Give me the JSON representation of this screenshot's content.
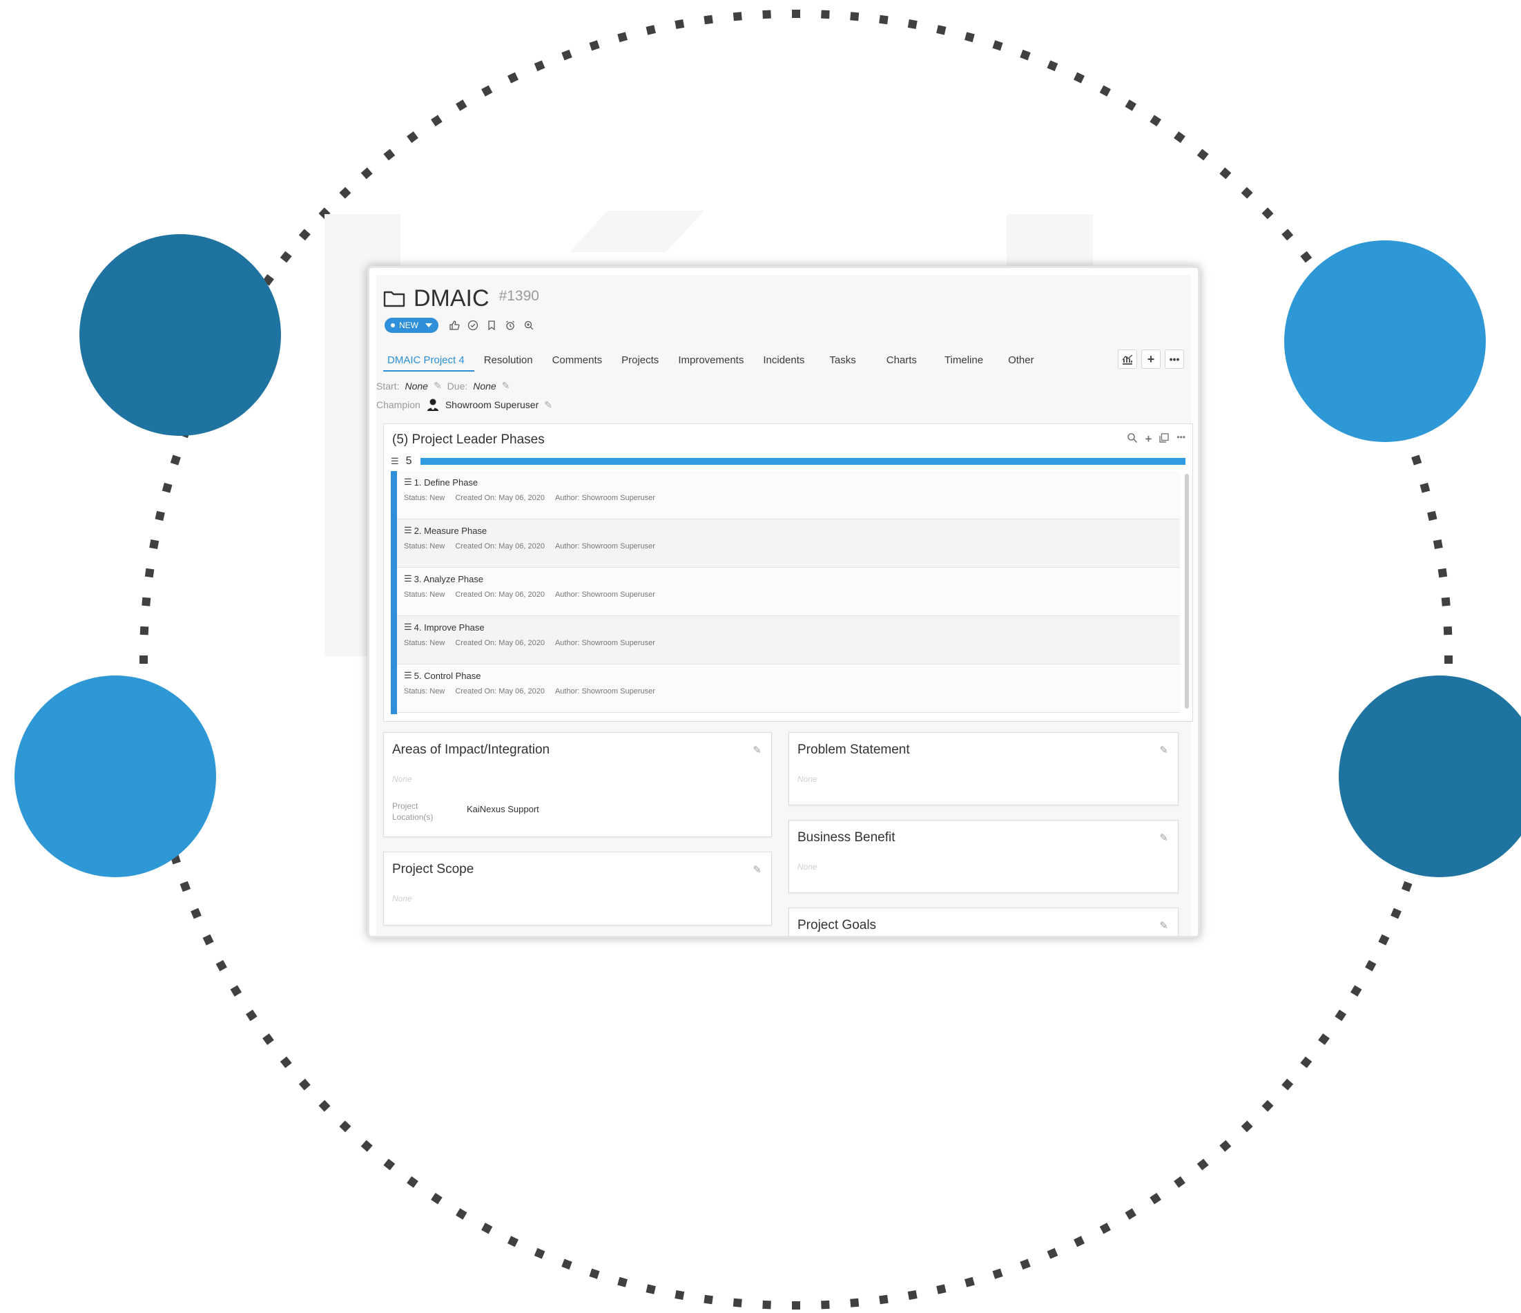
{
  "colors": {
    "dark_blue": "#1f73a0",
    "light_blue": "#2e98d6",
    "accent": "#2f8fd8",
    "dots": "#404040"
  },
  "app": {
    "title": "DMAIC",
    "number": "#1390",
    "status": "NEW",
    "action_icons": [
      "thumbs-up-icon",
      "check-circle-icon",
      "bookmark-icon",
      "alarm-clock-icon",
      "zoom-icon"
    ]
  },
  "tabs": [
    {
      "label": "DMAIC Project 4",
      "active": true
    },
    {
      "label": "Resolution"
    },
    {
      "label": "Comments"
    },
    {
      "label": "Projects"
    },
    {
      "label": "Improvements"
    },
    {
      "label": "Incidents"
    },
    {
      "label": "Tasks"
    },
    {
      "label": "Charts"
    },
    {
      "label": "Timeline"
    },
    {
      "label": "Other"
    }
  ],
  "toolbar_icons": [
    "chart-icon",
    "plus-icon",
    "more-icon"
  ],
  "meta": {
    "start_label": "Start:",
    "start_value": "None",
    "due_label": "Due:",
    "due_value": "None",
    "champion_label": "Champion",
    "champion_value": "Showroom Superuser"
  },
  "phases_panel": {
    "title": "(5) Project Leader Phases",
    "count": "5",
    "progress": 1.0,
    "items": [
      {
        "title": "1. Define Phase",
        "status": "Status: New",
        "created": "Created On: May 06, 2020",
        "author": "Author: Showroom Superuser"
      },
      {
        "title": "2. Measure Phase",
        "status": "Status: New",
        "created": "Created On: May 06, 2020",
        "author": "Author: Showroom Superuser"
      },
      {
        "title": "3. Analyze Phase",
        "status": "Status: New",
        "created": "Created On: May 06, 2020",
        "author": "Author: Showroom Superuser"
      },
      {
        "title": "4. Improve Phase",
        "status": "Status: New",
        "created": "Created On: May 06, 2020",
        "author": "Author: Showroom Superuser"
      },
      {
        "title": "5. Control Phase",
        "status": "Status: New",
        "created": "Created On: May 06, 2020",
        "author": "Author: Showroom Superuser"
      }
    ]
  },
  "cards": {
    "areas": {
      "title": "Areas of Impact/Integration",
      "none": "None",
      "location_label": "Project Location(s)",
      "location_value": "KaiNexus Support"
    },
    "scope": {
      "title": "Project Scope",
      "none": "None"
    },
    "problem": {
      "title": "Problem Statement",
      "none": "None"
    },
    "benefit": {
      "title": "Business Benefit",
      "none": "None"
    },
    "goals": {
      "title": "Project Goals"
    }
  }
}
